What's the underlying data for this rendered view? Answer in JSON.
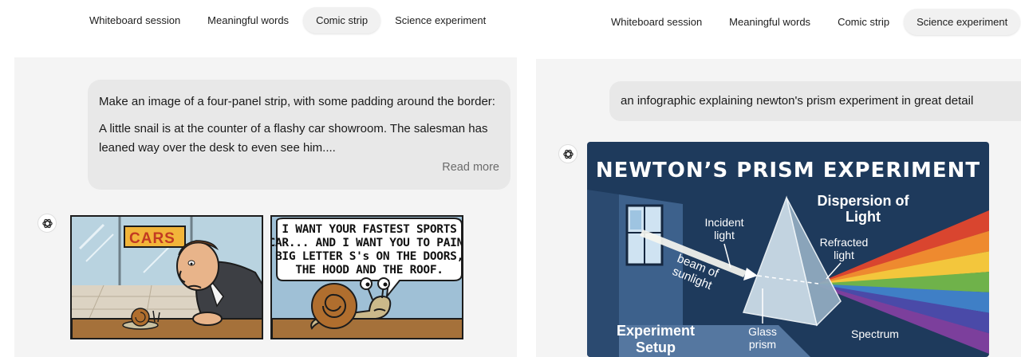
{
  "left": {
    "tabs": [
      {
        "label": "Whiteboard session",
        "active": false
      },
      {
        "label": "Meaningful words",
        "active": false
      },
      {
        "label": "Comic strip",
        "active": true
      },
      {
        "label": "Science experiment",
        "active": false
      }
    ],
    "prompt": {
      "line1": "Make an image of a four-panel strip, with some padding around the border:",
      "line2": "A little snail is at the counter of a flashy car showroom. The salesman has leaned way over the desk to even see him....",
      "read_more": "Read more"
    },
    "comic": {
      "sign": "CARS",
      "speech_lines": [
        "I WANT YOUR FASTEST SPORTS",
        "CAR... AND I WANT YOU TO PAINT",
        "BIG LETTER S's ON THE DOORS,",
        "THE HOOD AND THE ROOF."
      ]
    }
  },
  "right": {
    "tabs": [
      {
        "label": "Whiteboard session",
        "active": false
      },
      {
        "label": "Meaningful words",
        "active": false
      },
      {
        "label": "Comic strip",
        "active": false
      },
      {
        "label": "Science experiment",
        "active": true
      }
    ],
    "prompt": "an infographic explaining newton's prism experiment in great detail",
    "infographic": {
      "title": "NEWTON’S PRISM EXPERIMENT",
      "dispersion_line1": "Dispersion of",
      "dispersion_line2": "Light",
      "incident_line1": "Incident",
      "incident_line2": "light",
      "refracted_line1": "Refracted",
      "refracted_line2": "light",
      "beam_line1": "beam of",
      "beam_line2": "sunlight",
      "setup_line1": "Experiment",
      "setup_line2": "Setup",
      "glass_line1": "Glass",
      "glass_line2": "prism",
      "spectrum": "Spectrum"
    }
  },
  "colors": {
    "panel_bg": "#f4f4f4",
    "bubble_bg": "#e8e8e8",
    "infographic_bg": "#1e3a5c",
    "spectrum": [
      "#d9452f",
      "#ee8a2f",
      "#f3c63c",
      "#6fb24a",
      "#3f7fc6",
      "#4a4aa8",
      "#7c3f9c"
    ]
  }
}
